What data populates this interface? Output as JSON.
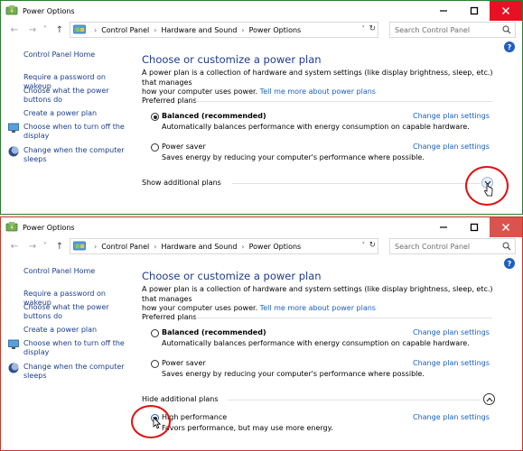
{
  "windows": [
    {
      "title": "Power Options",
      "breadcrumb": [
        "Control Panel",
        "Hardware and Sound",
        "Power Options"
      ],
      "search_placeholder": "Search Control Panel",
      "sidebar": {
        "home": "Control Panel Home",
        "links": [
          {
            "line1": "Require a password on wakeup",
            "line2": ""
          },
          {
            "line1": "Choose what the power",
            "line2": "buttons do"
          },
          {
            "line1": "Create a power plan",
            "line2": ""
          },
          {
            "line1": "Choose when to turn off the",
            "line2": "display"
          },
          {
            "line1": "Change when the computer",
            "line2": "sleeps"
          }
        ]
      },
      "main": {
        "heading": "Choose or customize a power plan",
        "desc_line1": "A power plan is a collection of hardware and system settings (like display brightness, sleep, etc.) that manages",
        "desc_line2": "how your computer uses power.",
        "desc_link": "Tell me more about power plans",
        "preferred_label": "Preferred plans",
        "plans": [
          {
            "name": "Balanced (recommended)",
            "desc": "Automatically balances performance with energy consumption on capable hardware.",
            "settings": "Change plan settings",
            "selected": true
          },
          {
            "name": "Power saver",
            "desc": "Saves energy by reducing your computer's performance where possible.",
            "settings": "Change plan settings",
            "selected": false
          }
        ],
        "toggle_label": "Show additional plans"
      }
    },
    {
      "title": "Power Options",
      "breadcrumb": [
        "Control Panel",
        "Hardware and Sound",
        "Power Options"
      ],
      "search_placeholder": "Search Control Panel",
      "sidebar": {
        "home": "Control Panel Home",
        "links": [
          {
            "line1": "Require a password on wakeup",
            "line2": ""
          },
          {
            "line1": "Choose what the power",
            "line2": "buttons do"
          },
          {
            "line1": "Create a power plan",
            "line2": ""
          },
          {
            "line1": "Choose when to turn off the",
            "line2": "display"
          },
          {
            "line1": "Change when the computer",
            "line2": "sleeps"
          }
        ]
      },
      "main": {
        "heading": "Choose or customize a power plan",
        "desc_line1": "A power plan is a collection of hardware and system settings (like display brightness, sleep, etc.) that manages",
        "desc_line2": "how your computer uses power.",
        "desc_link": "Tell me more about power plans",
        "preferred_label": "Preferred plans",
        "plans": [
          {
            "name": "Balanced (recommended)",
            "desc": "Automatically balances performance with energy consumption on capable hardware.",
            "settings": "Change plan settings",
            "selected": false
          },
          {
            "name": "Power saver",
            "desc": "Saves energy by reducing your computer's performance where possible.",
            "settings": "Change plan settings",
            "selected": false
          }
        ],
        "toggle_label": "Hide additional plans",
        "extra_plan": {
          "name": "High performance",
          "desc": "Favors performance, but may use more energy.",
          "settings": "Change plan settings",
          "selected": true
        }
      }
    }
  ],
  "colors": {
    "link": "#1a5fc0",
    "heading": "#1e3b8c",
    "annotation_ring": "#e01010",
    "close_button_top": "#e81123",
    "close_button_bottom": "#d9534f",
    "window_border_top": "#2e7d2e",
    "window_border_bottom": "#c0392b"
  }
}
